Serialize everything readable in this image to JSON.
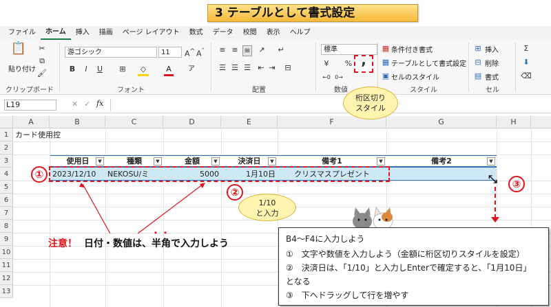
{
  "title": "3  テーブルとして書式設定",
  "menu": [
    "ファイル",
    "ホーム",
    "挿入",
    "描画",
    "ページ レイアウト",
    "数式",
    "データ",
    "校閲",
    "表示",
    "ヘルプ"
  ],
  "ribbon": {
    "paste_label": "貼り付け",
    "clipboard_label": "クリップボード",
    "font_name": "游ゴシック",
    "font_size": "11",
    "font_group_label": "フォント",
    "align_group_label": "配置",
    "number_format": "標準",
    "number_group_label": "数値",
    "cond_format": "条件付き書式",
    "table_format": "テーブルとして書式設定",
    "cell_style": "セルのスタイル",
    "style_group_label": "スタイル",
    "insert": "挿入",
    "delete": "削除",
    "format": "書式",
    "cell_group_label": "セル",
    "comma_style_glyph": ","
  },
  "formula_bar": {
    "name_box": "L19",
    "fx": "fx",
    "cancel": "✕",
    "enter": "✓"
  },
  "columns": [
    "A",
    "B",
    "C",
    "D",
    "E",
    "F",
    "G",
    "H"
  ],
  "rows": [
    "1",
    "2",
    "3",
    "4",
    "5",
    "6",
    "7",
    "8",
    "9",
    "10",
    "11",
    "12",
    "13"
  ],
  "sheet": {
    "a2": "カード使用控",
    "headers": [
      "使用日",
      "種類",
      "金額",
      "決済日",
      "備考1",
      "備考2"
    ],
    "row4": {
      "date": "2023/12/10",
      "type": "NEKOSU/ミ",
      "amount": "5000",
      "settle": "1月10日",
      "note1": "クリスマスプレゼント",
      "note2": ""
    }
  },
  "callouts": {
    "comma_style": "桁区切り\nスタイル",
    "input_hint": "1/10\nと入力",
    "num1": "①",
    "num2": "②",
    "num3": "③",
    "warning_prefix": "注意！",
    "warning_text": "日付・数値は、半角で入力しよう",
    "emphasis_dots": "・・"
  },
  "note": {
    "heading": "B4～F4に入力しよう",
    "items": [
      "①　文字や数値を入力しよう（金額に桁区切りスタイルを設定）",
      "②　決済日は、「1/10」と入力しEnterで確定すると、「1月10日」となる",
      "③　下へドラッグして行を増やす"
    ]
  },
  "colors": {
    "accent_red": "#e0121b",
    "table_blue": "#2e6fb5",
    "selected_row": "#cfe8f5",
    "excel_green": "#1e7a45"
  }
}
